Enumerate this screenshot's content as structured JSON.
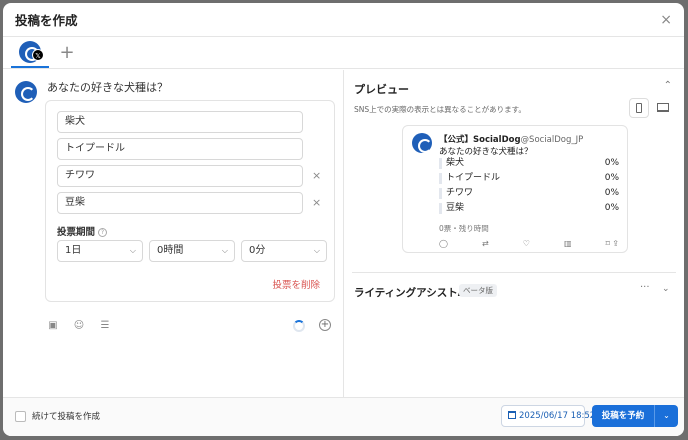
{
  "header": {
    "title": "投稿を作成",
    "close_icon": "×"
  },
  "tabs": {
    "account_icon": "socialdog-avatar",
    "badge": "𝕏",
    "add": "+"
  },
  "composer": {
    "question": "あなたの好きな犬種は？",
    "options": [
      "柴犬",
      "トイプードル",
      "チワワ",
      "豆柴"
    ],
    "remove": "×",
    "duration_label": "投票期間",
    "help": "?",
    "duration": {
      "days": "1日",
      "hours": "0時間",
      "minutes": "0分"
    },
    "chevron": "⌵",
    "delete_poll": "投票を削除",
    "tools": {
      "image": "▣",
      "emoji": "☺",
      "list": "☰"
    },
    "add_post": "+"
  },
  "preview": {
    "title": "プレビュー",
    "caret": "⌃",
    "note": "SNS上での実際の表示とは異なることがあります。",
    "account_name": "【公式】SocialDog",
    "handle": "@SocialDog_JP",
    "question": "あなたの好きな犬種は？",
    "results": [
      {
        "label": "柴犬",
        "percent": "0%"
      },
      {
        "label": "トイプードル",
        "percent": "0%"
      },
      {
        "label": "チワワ",
        "percent": "0%"
      },
      {
        "label": "豆柴",
        "percent": "0%"
      }
    ],
    "meta": "0票・残り時間",
    "actions": {
      "reply": "◯",
      "repost": "⇄",
      "like": "♡",
      "stats": "▥",
      "bookmark": "⌑",
      "share": "⇪"
    }
  },
  "assistant": {
    "title": "ライティングアシストAI",
    "badge": "ベータ版",
    "more": "···",
    "caret": "⌄"
  },
  "footer": {
    "continue_label": "続けて投稿を作成",
    "date": "2025/06/17 18:52",
    "schedule_label": "投稿を予約",
    "split": "⌄"
  },
  "colors": {
    "accent": "#1a6fd9",
    "danger": "#d9534f"
  }
}
